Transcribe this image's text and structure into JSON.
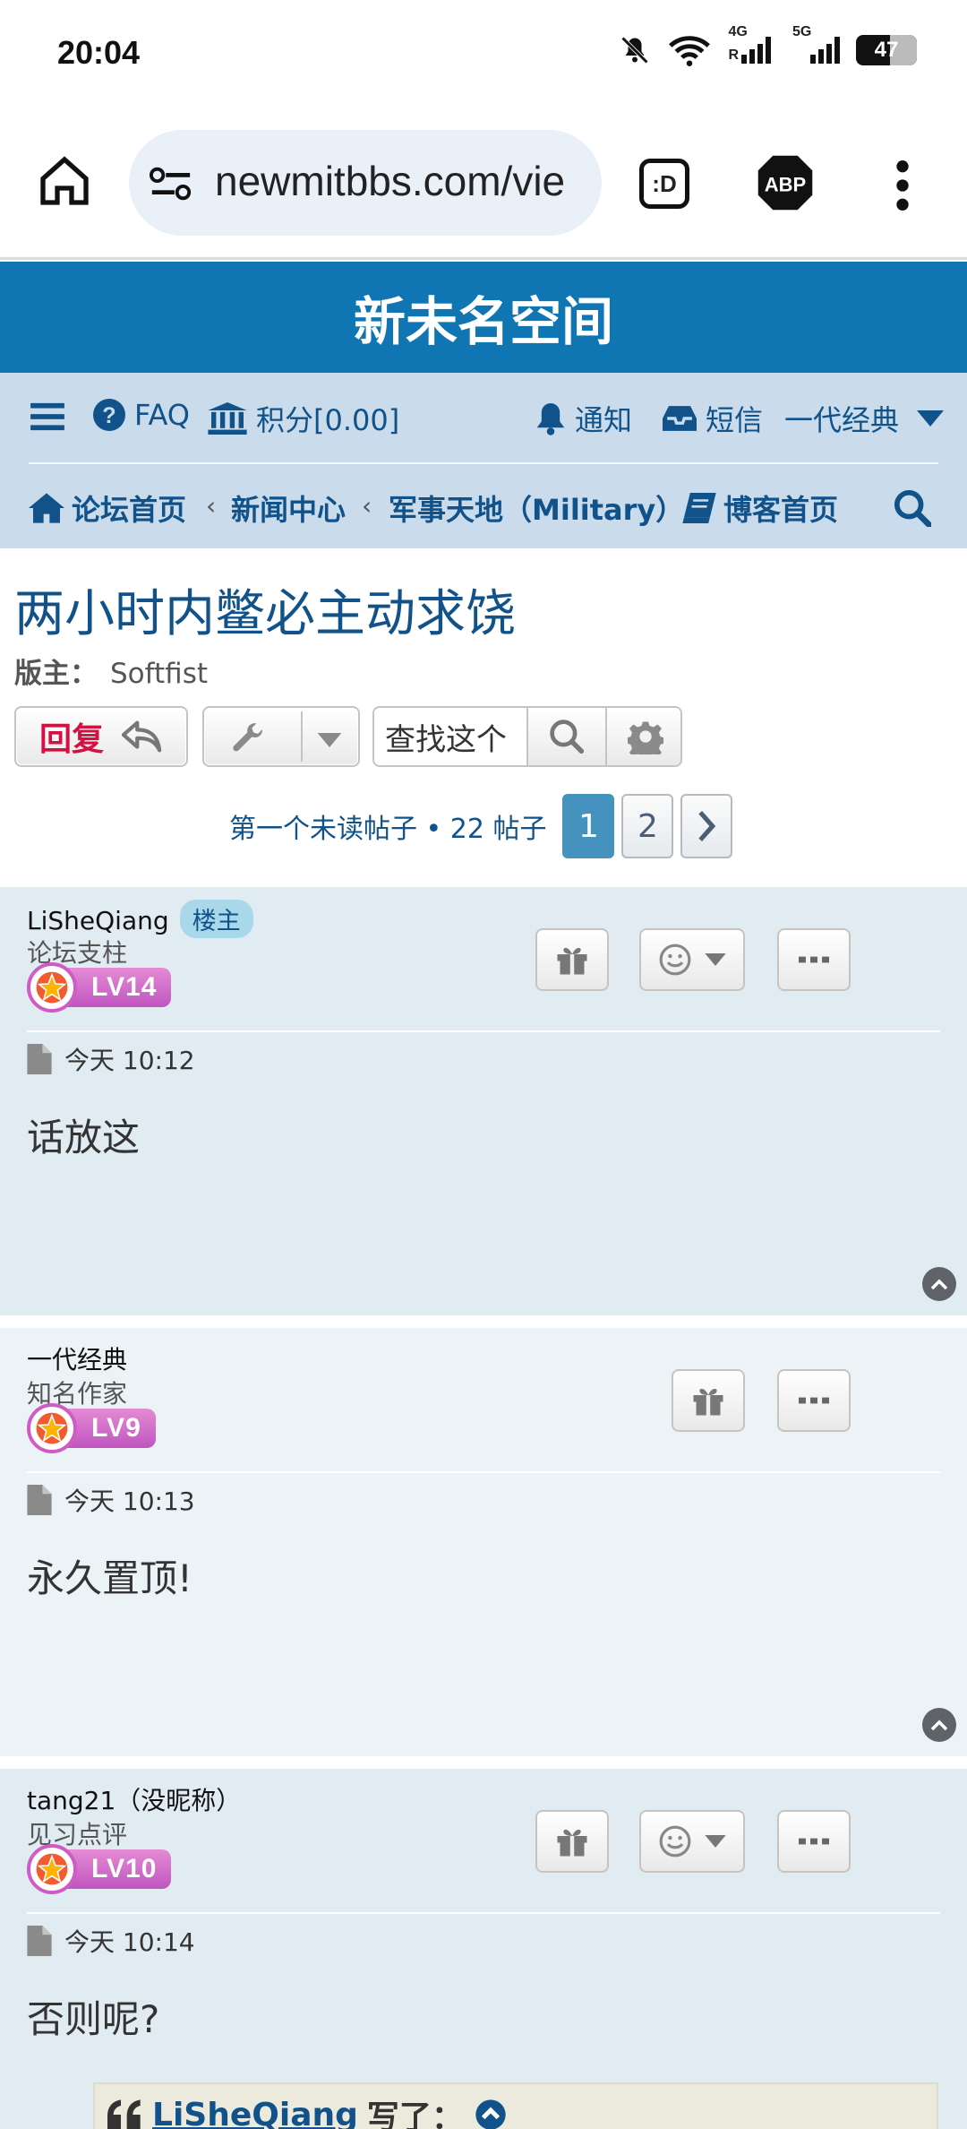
{
  "status_bar": {
    "time": "20:04",
    "battery": "47",
    "net1": "4G",
    "net2": "5G",
    "roaming": "R"
  },
  "browser": {
    "url": "newmitbbs.com/vie",
    "tab_label": ":D",
    "abp_label": "ABP"
  },
  "site": {
    "title": "新未名空间"
  },
  "nav": {
    "faq": "FAQ",
    "points": "积分[0.00]",
    "notifications": "通知",
    "messages": "短信",
    "username": "一代经典",
    "breadcrumbs": [
      "论坛首页",
      "新闻中心",
      "军事天地（Military）"
    ],
    "blog": "博客首页"
  },
  "topic": {
    "title": "两小时内鳖必主动求饶",
    "moderator_label": "版主：",
    "moderator": "Softfist",
    "reply_label": "回复",
    "search_placeholder": "查找这个",
    "pagination_info": "第一个未读帖子 • 22 帖子",
    "pages": [
      "1",
      "2"
    ]
  },
  "posts": [
    {
      "author": "LiSheQiang",
      "badge": "楼主",
      "rank": "论坛支柱",
      "level": "LV14",
      "time": "今天 10:12",
      "content": "话放这"
    },
    {
      "author": "一代经典",
      "rank": "知名作家",
      "level": "LV9",
      "time": "今天 10:13",
      "content": "永久置顶!"
    },
    {
      "author": "tang21（没昵称）",
      "rank": "见习点评",
      "level": "LV10",
      "time": "今天 10:14",
      "content": "否则呢?",
      "quote": {
        "author": "LiSheQiang",
        "suffix": "写了："
      }
    }
  ],
  "colors": {
    "brand": "#0f76b3",
    "nav_bg": "#cadceb",
    "link": "#105289",
    "reply": "#d31141",
    "page_active": "#4692bf"
  }
}
